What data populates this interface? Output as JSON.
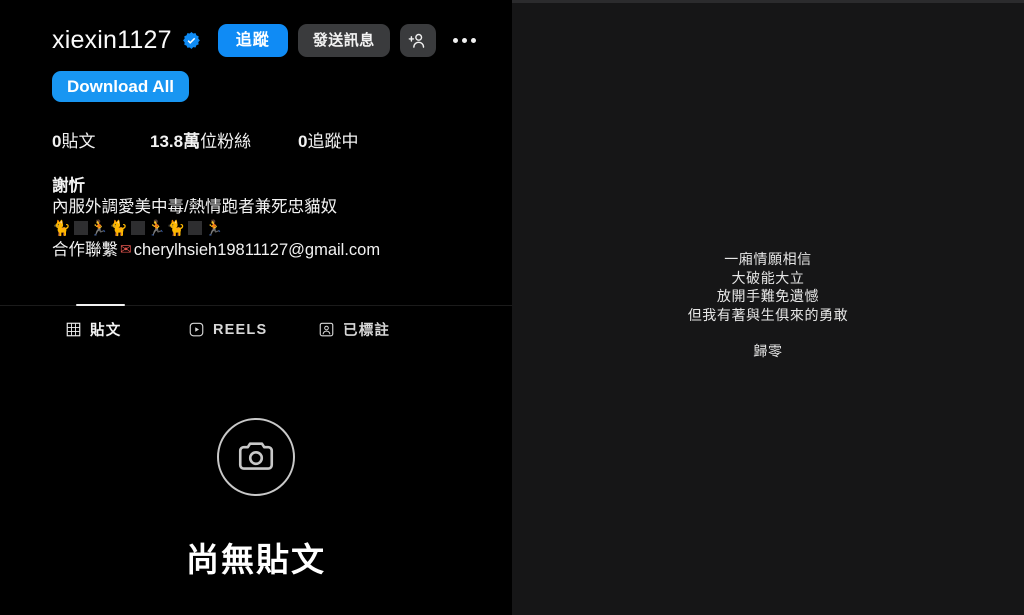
{
  "app": {
    "platform": "instagram-profile",
    "accent_blue": "#0f8bf5",
    "download_blue": "#1896f2",
    "button_gray": "#3a3b3d",
    "left_bg": "#000000",
    "right_bg": "#161617"
  },
  "profile": {
    "username": "xiexin1127",
    "verified": true,
    "verified_icon": "verified-badge-icon",
    "actions": {
      "follow_label": "追蹤",
      "message_label": "發送訊息",
      "add_person_icon": "person-add-icon",
      "more_icon": "more-options-icon",
      "download_all_label": "Download All"
    },
    "stats": [
      {
        "value": "0",
        "label": "貼文",
        "name": "posts"
      },
      {
        "value": "13.8萬",
        "label": "位粉絲",
        "name": "followers"
      },
      {
        "value": "0",
        "label": "追蹤中",
        "name": "following"
      }
    ],
    "bio": {
      "display_name": "謝忻",
      "line1": "內服外調愛美中毒/熱情跑者兼死忠貓奴",
      "emoji_line": {
        "pet": "🐈",
        "tofu": "□",
        "runner": "🏃",
        "repeat": 3
      },
      "contact_label": "合作聯繫",
      "contact_icon": "love-letter-icon",
      "email": "cherylhsieh19811127@gmail.com"
    }
  },
  "tabs": [
    {
      "label": "貼文",
      "icon": "grid-icon",
      "active": true,
      "name": "posts"
    },
    {
      "label": "REELS",
      "icon": "reels-icon",
      "active": false,
      "name": "reels"
    },
    {
      "label": "已標註",
      "icon": "tagged-icon",
      "active": false,
      "name": "tagged"
    }
  ],
  "empty_state": {
    "icon": "camera-icon",
    "title": "尚無貼文"
  },
  "right_panel": {
    "quote_lines": [
      "一廂情願相信",
      "大破能大立",
      "放開手難免遺憾",
      "但我有著與生俱來的勇敢"
    ],
    "closing_line": "歸零"
  }
}
